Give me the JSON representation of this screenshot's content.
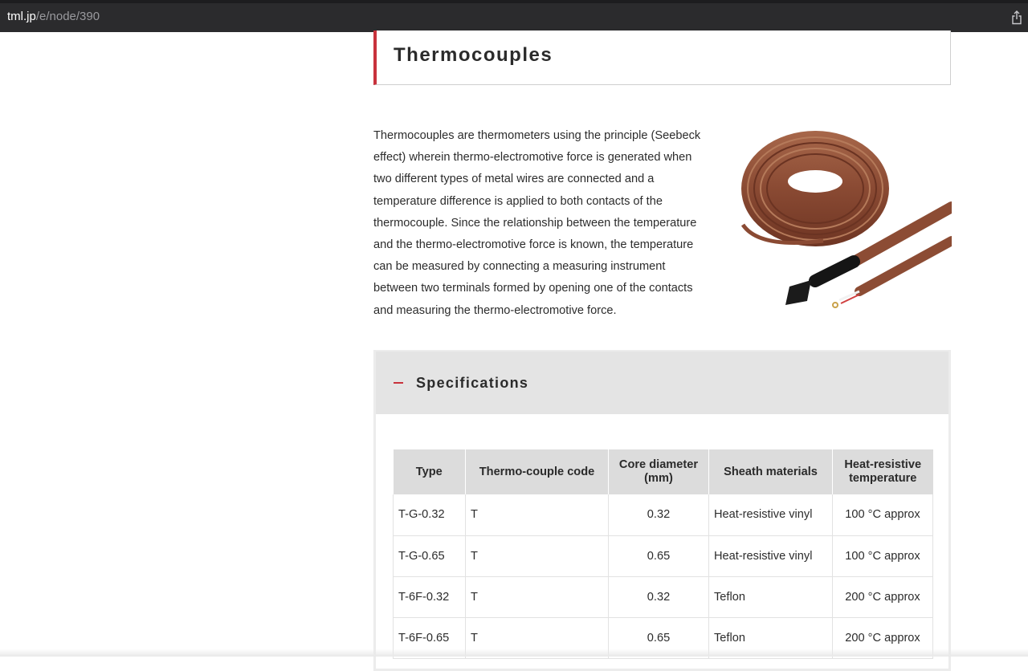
{
  "browser": {
    "url_domain": "tml.jp",
    "url_path": "/e/node/390"
  },
  "page": {
    "title": "Thermocouples",
    "description": "Thermocouples are thermometers using the principle (Seebeck effect) wherein thermo-electromotive force is generated when two different types of metal wires are connected and a temperature difference is applied to both contacts of the thermocouple. Since the relationship between the temperature and the thermo-electromotive force is known, the temperature can be measured by connecting a measuring instrument between two terminals formed by opening one of the contacts and measuring the thermo-electromotive force."
  },
  "specifications": {
    "toggle_symbol": "−",
    "title": "Specifications",
    "headers": [
      "Type",
      "Thermo-couple code",
      "Core diameter (mm)",
      "Sheath materials",
      "Heat-resistive temperature"
    ],
    "rows": [
      [
        "T-G-0.32",
        "T",
        "0.32",
        "Heat-resistive vinyl",
        "100 °C approx"
      ],
      [
        "T-G-0.65",
        "T",
        "0.65",
        "Heat-resistive vinyl",
        "100 °C approx"
      ],
      [
        "T-6F-0.32",
        "T",
        "0.32",
        "Teflon",
        "200 °C approx"
      ],
      [
        "T-6F-0.65",
        "T",
        "0.65",
        "Teflon",
        "200 °C approx"
      ]
    ]
  },
  "icons": {
    "share": "share-icon",
    "product_image": "thermocouple-cable-image"
  },
  "colors": {
    "accent": "#c8323c",
    "header_bg": "#e4e4e4",
    "table_header_bg": "#dcdcdc"
  }
}
